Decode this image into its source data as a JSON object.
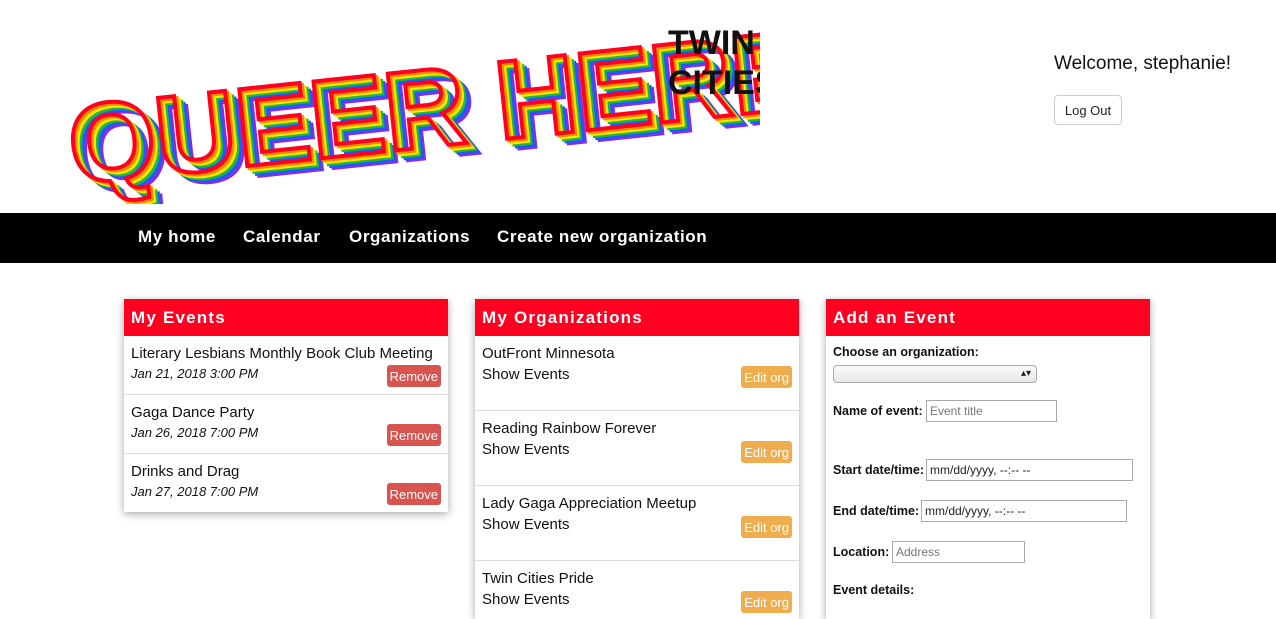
{
  "brand": {
    "logo_main": "QUEER HERE",
    "logo_sub_1": "TWIN",
    "logo_sub_2": "CITIES",
    "stripe_colors": [
      "#ff0020",
      "#ff8a00",
      "#ffe600",
      "#1eb83c",
      "#1a5bff",
      "#8a2be2"
    ]
  },
  "header": {
    "welcome": "Welcome, stephanie!",
    "logout_label": "Log Out"
  },
  "nav": {
    "items": [
      "My home",
      "Calendar",
      "Organizations",
      "Create new organization"
    ]
  },
  "my_events": {
    "title": "My Events",
    "remove_label": "Remove",
    "items": [
      {
        "title": "Literary Lesbians Monthly Book Club Meeting",
        "date": "Jan 21, 2018 3:00 PM"
      },
      {
        "title": "Gaga Dance Party",
        "date": "Jan 26, 2018 7:00 PM"
      },
      {
        "title": "Drinks and Drag",
        "date": "Jan 27, 2018 7:00 PM"
      }
    ]
  },
  "my_orgs": {
    "title": "My Organizations",
    "show_events_label": "Show Events",
    "edit_label": "Edit org",
    "items": [
      {
        "name": "OutFront Minnesota"
      },
      {
        "name": "Reading Rainbow Forever"
      },
      {
        "name": "Lady Gaga Appreciation Meetup"
      },
      {
        "name": "Twin Cities Pride"
      }
    ]
  },
  "add_event": {
    "title": "Add an Event",
    "org_label": "Choose an organization:",
    "org_value": "",
    "name_label": "Name of event:",
    "name_placeholder": "Event title",
    "start_label": "Start date/time:",
    "start_value": "mm/dd/yyyy, --:-- --",
    "end_label": "End date/time:",
    "end_value": "mm/dd/yyyy, --:-- --",
    "location_label": "Location:",
    "location_placeholder": "Address",
    "details_label": "Event details:"
  },
  "colors": {
    "accent_red": "#ff0020",
    "nav_bg": "#000000",
    "remove_btn": "#d9534f",
    "edit_btn": "#f0ad4e"
  }
}
